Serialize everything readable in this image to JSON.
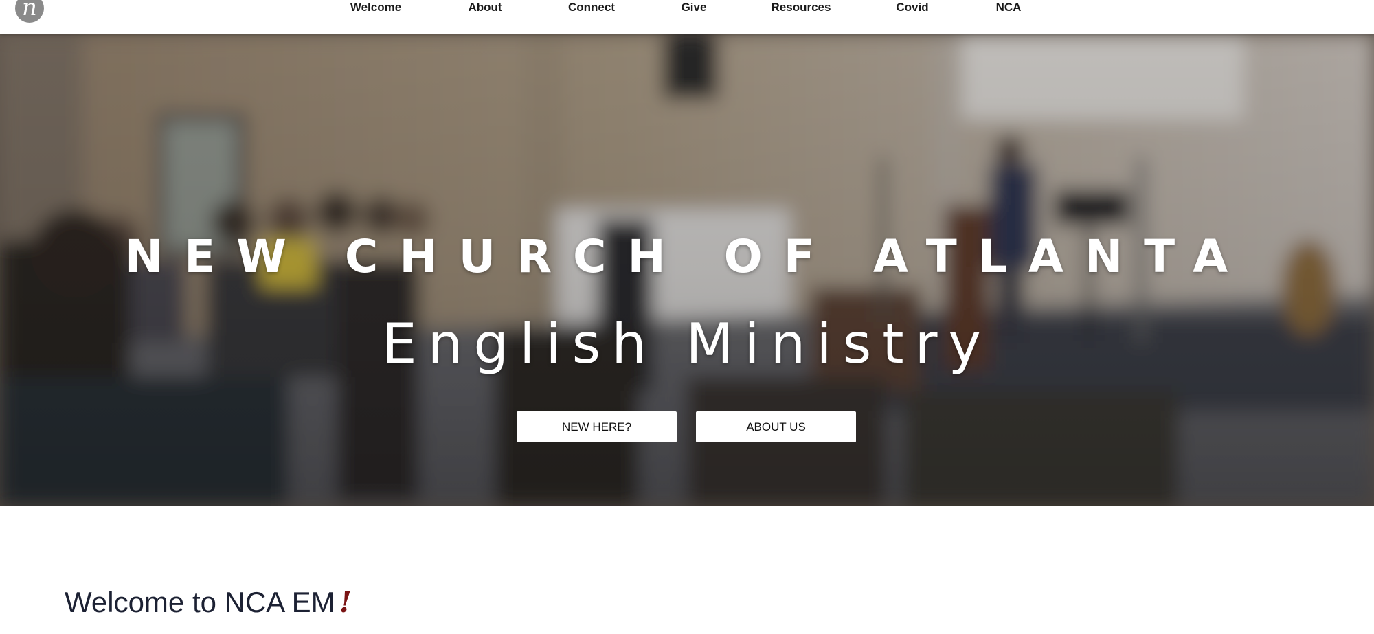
{
  "logo": {
    "glyph": "n",
    "icon": "nca-logo-icon",
    "color": "#8a8a8a"
  },
  "nav": {
    "items": [
      {
        "label": "Welcome"
      },
      {
        "label": "About"
      },
      {
        "label": "Connect"
      },
      {
        "label": "Give"
      },
      {
        "label": "Resources"
      },
      {
        "label": "Covid"
      },
      {
        "label": "NCA"
      }
    ]
  },
  "hero": {
    "title": "NEW CHURCH OF ATLANTA",
    "subtitle": "English Ministry",
    "buttons": {
      "new_here": "NEW HERE?",
      "about_us": "ABOUT US"
    },
    "background": "blurred-church-service-photo"
  },
  "welcome": {
    "heading": "Welcome to NCA EM",
    "exclamation": "!",
    "accent_color": "#7a1414"
  }
}
